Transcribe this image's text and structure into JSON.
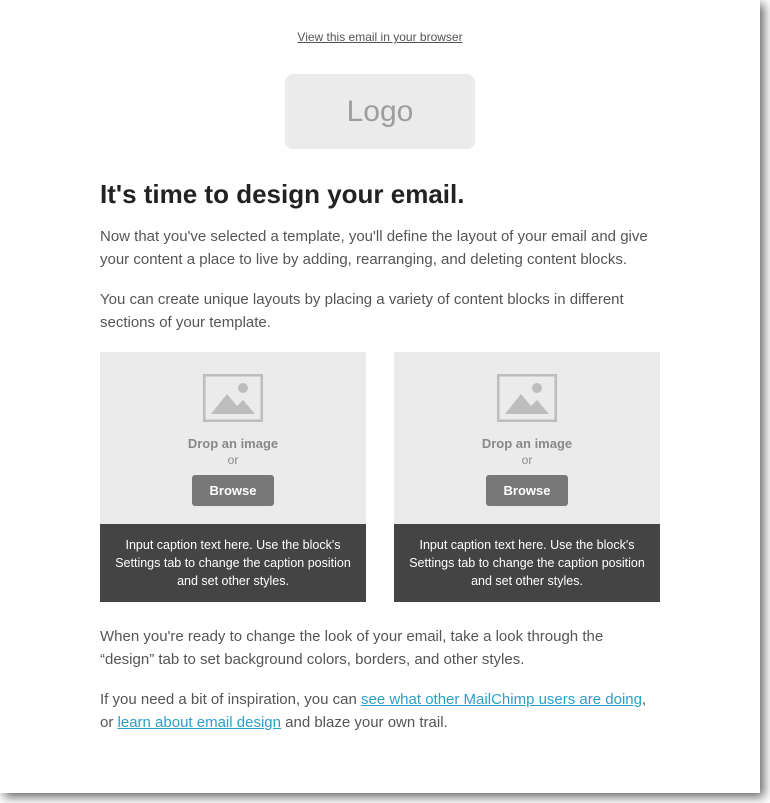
{
  "viewLink": "View this email in your browser",
  "logo": "Logo",
  "title": "It's time to design your email.",
  "para1": "Now that you've selected a template, you'll define the layout of your email and give your content a place to live by adding, rearranging, and deleting content blocks.",
  "para2": "You can create unique layouts by placing a variety of content blocks in different sections of your template.",
  "cards": [
    {
      "dropLabel": "Drop an image",
      "or": "or",
      "browse": "Browse",
      "caption": "Input caption text here. Use the block's Settings tab to change the caption position and set other styles."
    },
    {
      "dropLabel": "Drop an image",
      "or": "or",
      "browse": "Browse",
      "caption": "Input caption text here. Use the block's Settings tab to change the caption position and set other styles."
    }
  ],
  "para3": "When you're ready to change the look of your email, take a look through the “design” tab to set background colors, borders, and other styles.",
  "para4a": "If you need a bit of inspiration, you can ",
  "link1": "see what other MailChimp users are doing",
  "para4b": ", or ",
  "link2": "learn about email design",
  "para4c": " and blaze your own trail."
}
